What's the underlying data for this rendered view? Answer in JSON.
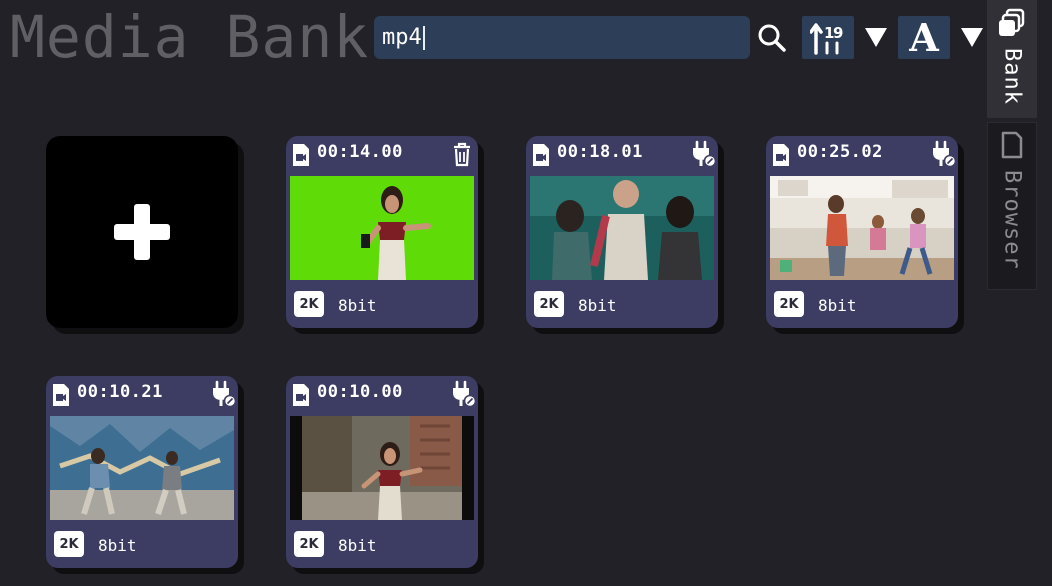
{
  "header": {
    "title": "Media Bank",
    "search": {
      "value": "mp4"
    },
    "search_icon": "magnifier-icon",
    "sort_icon": "sort-icon",
    "font_button_label": "A",
    "dropdown_icon": "triangle-down-icon"
  },
  "side_tabs": [
    {
      "label": "Bank",
      "icon": "stack-icon",
      "active": true
    },
    {
      "label": "Browser",
      "icon": "folder-icon",
      "active": false
    }
  ],
  "add_tile": {
    "icon": "plus-icon"
  },
  "media": [
    {
      "duration": "00:14.00",
      "resolution": "2K",
      "bitdepth": "8bit",
      "action_icon": "trash-icon",
      "thumb": "green-screen"
    },
    {
      "duration": "00:18.01",
      "resolution": "2K",
      "bitdepth": "8bit",
      "action_icon": "plug-icon",
      "thumb": "teal-group"
    },
    {
      "duration": "00:25.02",
      "resolution": "2K",
      "bitdepth": "8bit",
      "action_icon": "plug-icon",
      "thumb": "kitchen"
    },
    {
      "duration": "00:10.21",
      "resolution": "2K",
      "bitdepth": "8bit",
      "action_icon": "plug-icon",
      "thumb": "graffiti"
    },
    {
      "duration": "00:10.00",
      "resolution": "2K",
      "bitdepth": "8bit",
      "action_icon": "plug-icon",
      "thumb": "street"
    }
  ],
  "colors": {
    "background": "#222127",
    "card": "#3d3d63",
    "search_field": "#2c3e58",
    "title_text": "#5f5f64"
  }
}
